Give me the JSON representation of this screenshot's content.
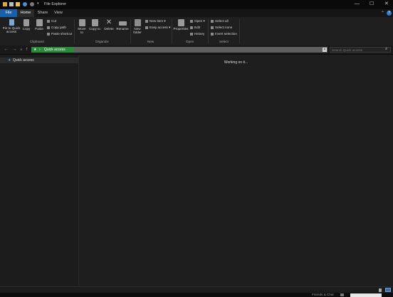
{
  "window": {
    "title": "File Explorer"
  },
  "tabs": [
    {
      "label": "File"
    },
    {
      "label": "Home"
    },
    {
      "label": "Share"
    },
    {
      "label": "View"
    }
  ],
  "ribbon": {
    "clipboard": {
      "pin_label": "Pin to Quick access",
      "copy_label": "Copy",
      "paste_label": "Paste",
      "cut_label": "Cut",
      "copy_path_label": "Copy path",
      "paste_shortcut_label": "Paste shortcut",
      "group_label": "Clipboard"
    },
    "organize": {
      "move_to_label": "Move to",
      "copy_to_label": "Copy to",
      "delete_label": "Delete",
      "rename_label": "Rename",
      "group_label": "Organize"
    },
    "new": {
      "new_folder_label": "New folder",
      "new_item_label": "New item",
      "easy_access_label": "Easy access",
      "group_label": "New"
    },
    "open": {
      "properties_label": "Properties",
      "open_label": "Open",
      "edit_label": "Edit",
      "history_label": "History",
      "group_label": "Open"
    },
    "select": {
      "select_all_label": "Select all",
      "select_none_label": "Select none",
      "invert_label": "Invert selection",
      "group_label": "Select"
    }
  },
  "address": {
    "path": "Quick access",
    "search_placeholder": "Search Quick access"
  },
  "nav_pane": {
    "quick_access_label": "Quick access"
  },
  "content": {
    "status_message": "Working on it..."
  },
  "taskbar": {
    "friends_label": "Friends & Chat"
  },
  "colors": {
    "accent": "#1a5fa8",
    "address_highlight": "#2a8a3a"
  }
}
